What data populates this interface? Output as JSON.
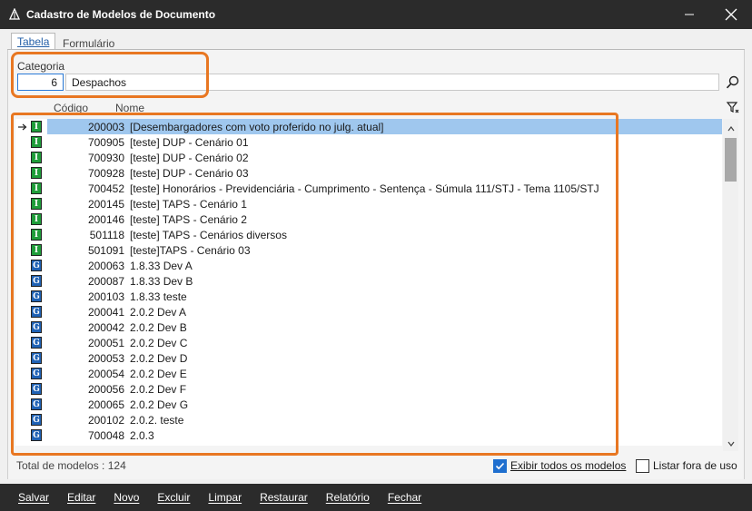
{
  "window": {
    "title": "Cadastro de Modelos de Documento"
  },
  "tabs": [
    {
      "label": "Tabela"
    },
    {
      "label": "Formulário"
    }
  ],
  "categoria": {
    "label": "Categoria",
    "code": "6",
    "name": "Despachos"
  },
  "columns": {
    "codigo": "Código",
    "nome": "Nome"
  },
  "rows": [
    {
      "type": "T",
      "code": "200003",
      "name": "[Desembargadores com voto proferido no julg. atual]",
      "selected": true
    },
    {
      "type": "T",
      "code": "700905",
      "name": "[teste] DUP - Cenário 01"
    },
    {
      "type": "T",
      "code": "700930",
      "name": "[teste] DUP - Cenário 02"
    },
    {
      "type": "T",
      "code": "700928",
      "name": "[teste] DUP - Cenário 03"
    },
    {
      "type": "T",
      "code": "700452",
      "name": "[teste] Honorários - Previdenciária - Cumprimento - Sentença - Súmula 111/STJ - Tema 1105/STJ"
    },
    {
      "type": "T",
      "code": "200145",
      "name": "[teste] TAPS - Cenário 1"
    },
    {
      "type": "T",
      "code": "200146",
      "name": "[teste] TAPS - Cenário 2"
    },
    {
      "type": "T",
      "code": "501118",
      "name": "[teste] TAPS - Cenários diversos"
    },
    {
      "type": "T",
      "code": "501091",
      "name": "[teste]TAPS - Cenário 03"
    },
    {
      "type": "G",
      "code": "200063",
      "name": "1.8.33 Dev A"
    },
    {
      "type": "G",
      "code": "200087",
      "name": "1.8.33 Dev B"
    },
    {
      "type": "G",
      "code": "200103",
      "name": "1.8.33 teste"
    },
    {
      "type": "G",
      "code": "200041",
      "name": "2.0.2 Dev A"
    },
    {
      "type": "G",
      "code": "200042",
      "name": "2.0.2 Dev B"
    },
    {
      "type": "G",
      "code": "200051",
      "name": "2.0.2 Dev C"
    },
    {
      "type": "G",
      "code": "200053",
      "name": "2.0.2 Dev D"
    },
    {
      "type": "G",
      "code": "200054",
      "name": "2.0.2 Dev E"
    },
    {
      "type": "G",
      "code": "200056",
      "name": "2.0.2 Dev F"
    },
    {
      "type": "G",
      "code": "200065",
      "name": "2.0.2 Dev G"
    },
    {
      "type": "G",
      "code": "200102",
      "name": "2.0.2. teste"
    },
    {
      "type": "G",
      "code": "700048",
      "name": "2.0.3"
    }
  ],
  "footer": {
    "total": "Total de modelos : 124",
    "show_all": {
      "label": "Exibir todos os modelos",
      "checked": true
    },
    "out_of_use": {
      "label": "Listar fora de uso",
      "checked": false
    }
  },
  "toolbar": {
    "salvar": "Salvar",
    "editar": "Editar",
    "novo": "Novo",
    "excluir": "Excluir",
    "limpar": "Limpar",
    "restaurar": "Restaurar",
    "relatorio": "Relatório",
    "fechar": "Fechar"
  },
  "colors": {
    "accent": "#1f6fcf",
    "highlight": "#e87722",
    "selection": "#9fc7ee",
    "type_T": "#1f9d3a",
    "type_G": "#1f62b5"
  },
  "icons": {
    "app": "scales-icon",
    "search": "search-icon",
    "filter": "filter-icon",
    "minimize": "minimize-icon",
    "close": "close-icon",
    "row_indicator": "arrow-right-icon"
  }
}
